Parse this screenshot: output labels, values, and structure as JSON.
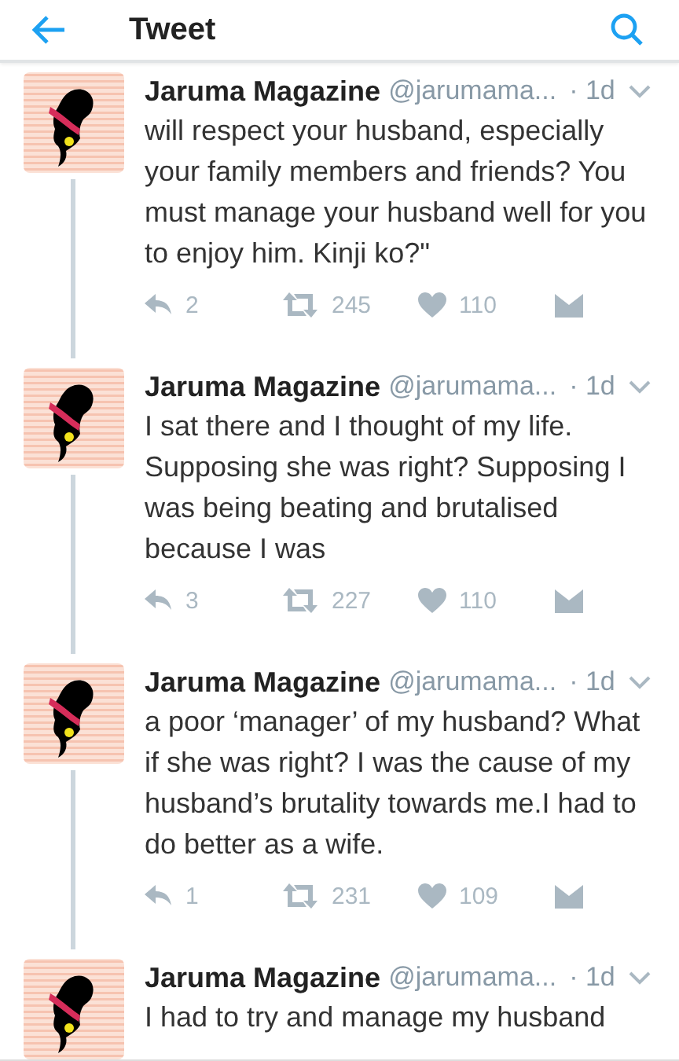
{
  "header": {
    "title": "Tweet"
  },
  "tweets": [
    {
      "name": "Jaruma Magazine",
      "handle": "@jarumama...",
      "time": "· 1d",
      "text": "will respect your husband, especially your family members and friends? You must manage your husband well for you to enjoy him. Kinji ko?\"",
      "stats": {
        "replies": "2",
        "retweets": "245",
        "likes": "110"
      }
    },
    {
      "name": "Jaruma Magazine",
      "handle": "@jarumama...",
      "time": "· 1d",
      "text": "I sat there and I thought of my life. Supposing she was right? Supposing I was being beating and brutalised because I was",
      "stats": {
        "replies": "3",
        "retweets": "227",
        "likes": "110"
      }
    },
    {
      "name": "Jaruma Magazine",
      "handle": "@jarumama...",
      "time": "· 1d",
      "text": "a poor ‘manager’ of my husband? What if she was right? I was the cause of my husband’s brutality towards me.I had to do better as a wife.",
      "stats": {
        "replies": "1",
        "retweets": "231",
        "likes": "109"
      }
    },
    {
      "name": "Jaruma Magazine",
      "handle": "@jarumama...",
      "time": "· 1d",
      "text": "I had to try and manage my husband"
    }
  ]
}
